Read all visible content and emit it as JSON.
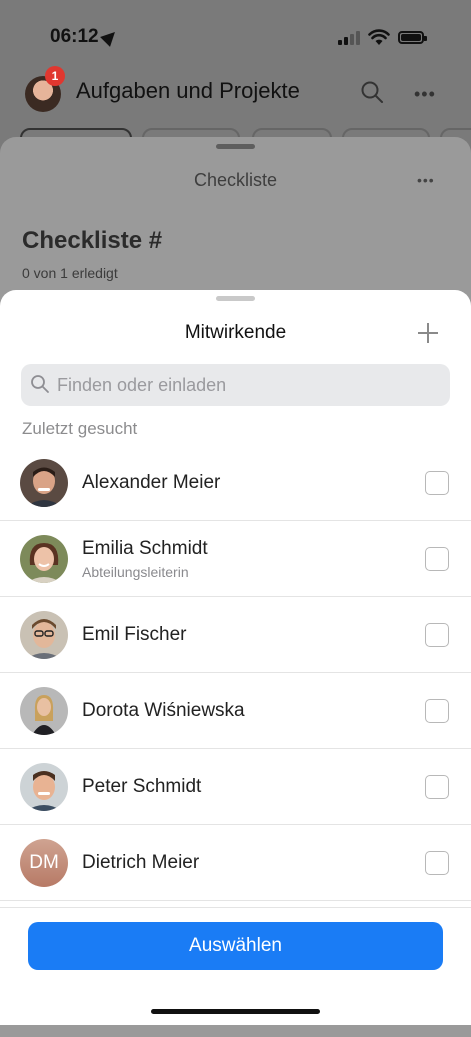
{
  "status_bar": {
    "time": "06:12"
  },
  "header": {
    "title": "Aufgaben und Projekte",
    "badge_count": "1",
    "more_glyph": "•••"
  },
  "checklist_sheet": {
    "title": "Checkliste",
    "more_glyph": "•••",
    "heading": "Checkliste #",
    "progress": "0 von 1 erledigt"
  },
  "contributors_sheet": {
    "title": "Mitwirkende",
    "search": {
      "placeholder": "Finden oder einladen",
      "value": ""
    },
    "section_label": "Zuletzt gesucht",
    "people": [
      {
        "name": "Alexander Meier",
        "subtitle": "",
        "checked": false
      },
      {
        "name": "Emilia Schmidt",
        "subtitle": "Abteilungsleiterin",
        "checked": false
      },
      {
        "name": "Emil Fischer",
        "subtitle": "",
        "checked": false
      },
      {
        "name": "Dorota Wiśniewska",
        "subtitle": "",
        "checked": false
      },
      {
        "name": "Peter Schmidt",
        "subtitle": "",
        "checked": false
      },
      {
        "name": "Dietrich Meier",
        "subtitle": "",
        "initials": "DM",
        "checked": false
      }
    ],
    "select_button": "Auswählen"
  },
  "colors": {
    "accent": "#1a7cf5",
    "badge": "#e0372f"
  }
}
